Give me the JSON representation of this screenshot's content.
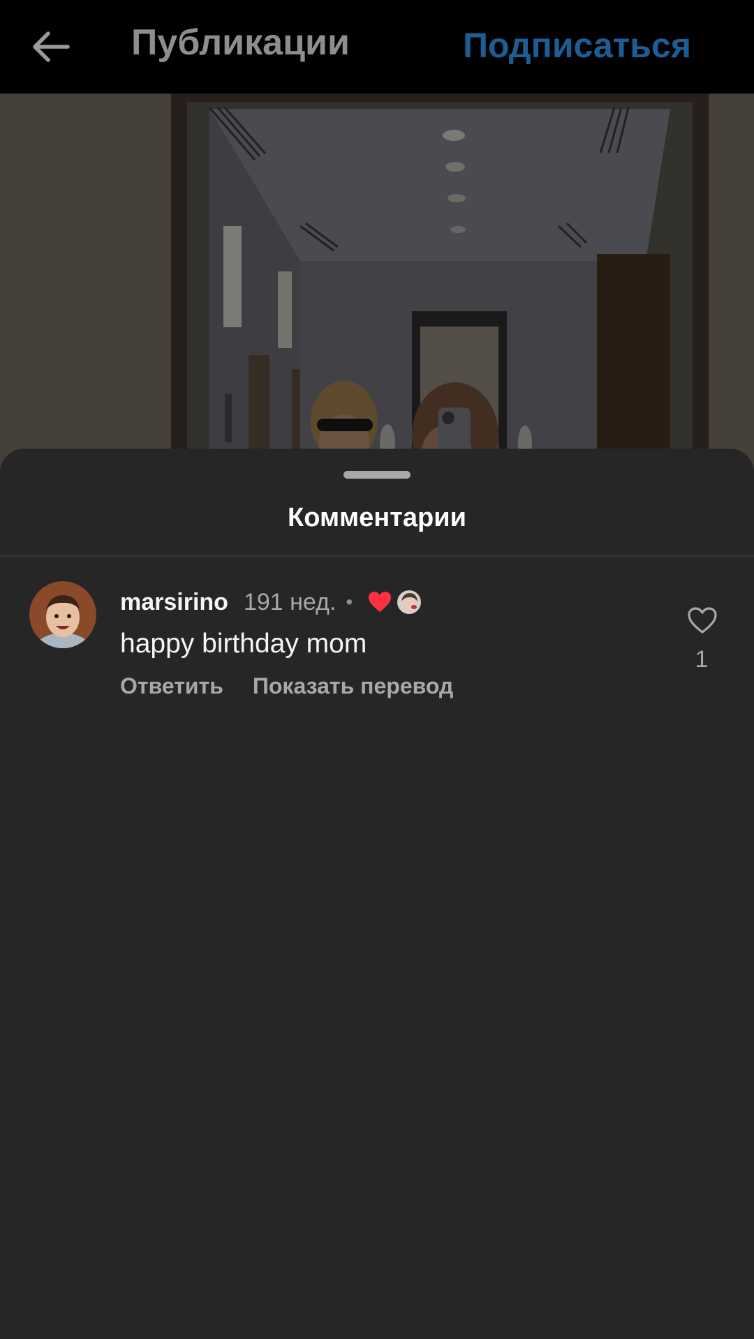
{
  "header": {
    "back_icon": "arrow-left-icon",
    "title": "Публикации",
    "follow_label": "Подписаться",
    "follow_color": "#1d5d96"
  },
  "comments_sheet": {
    "title": "Комментарии",
    "comments": [
      {
        "username": "marsirino",
        "time": "191 нед.",
        "separator": "•",
        "author_liked_icon": "heart-filled-icon",
        "text": "happy birthday mom",
        "reply_label": "Ответить",
        "translate_label": "Показать перевод",
        "like_icon": "heart-outline-icon",
        "like_count": "1"
      }
    ]
  },
  "colors": {
    "sheet_background": "#262626",
    "top_bar_background": "#000000",
    "author_heart": "#ff3040"
  }
}
